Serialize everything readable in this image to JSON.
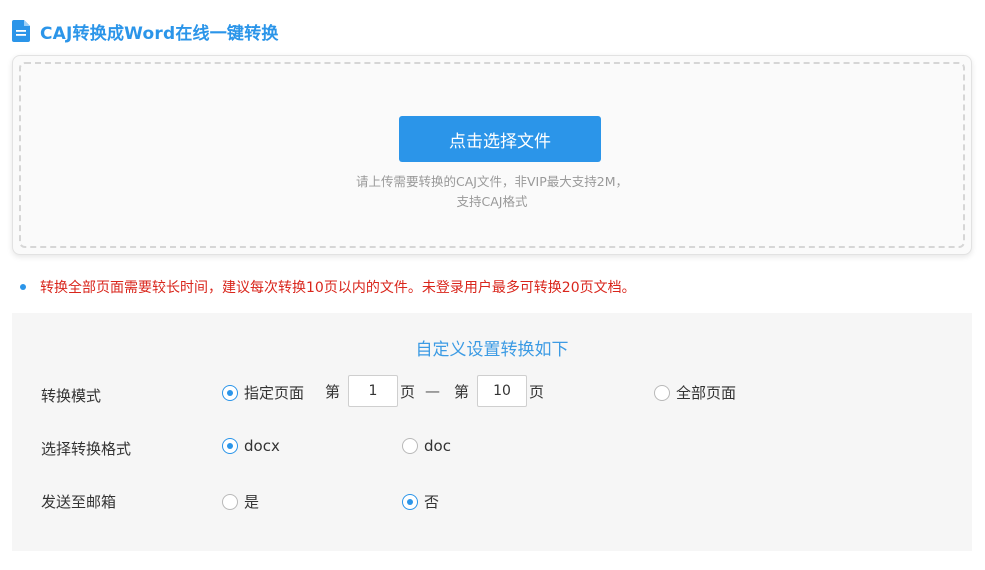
{
  "header": {
    "title": "CAJ转换成Word在线一键转换",
    "icon": "document-icon"
  },
  "upload": {
    "button_label": "点击选择文件",
    "hint_line1": "请上传需要转换的CAJ文件，非VIP最大支持2M，",
    "hint_line2": "支持CAJ格式"
  },
  "notice": {
    "text": "转换全部页面需要较长时间，建议每次转换10页以内的文件。未登录用户最多可转换20页文档。"
  },
  "settings": {
    "title": "自定义设置转换如下",
    "mode": {
      "label": "转换模式",
      "option_specific": "指定页面",
      "from_prefix": "第",
      "from_value": "1",
      "from_suffix": "页",
      "separator": "—",
      "to_prefix": "第",
      "to_value": "10",
      "to_suffix": "页",
      "option_all": "全部页面",
      "selected": "指定页面"
    },
    "format": {
      "label": "选择转换格式",
      "option_docx": "docx",
      "option_doc": "doc",
      "selected": "docx"
    },
    "email": {
      "label": "发送至邮箱",
      "option_yes": "是",
      "option_no": "否",
      "selected": "否"
    }
  },
  "colors": {
    "accent": "#2b95e9",
    "warning": "#d9261c",
    "panel_bg": "#f6f6f6"
  }
}
